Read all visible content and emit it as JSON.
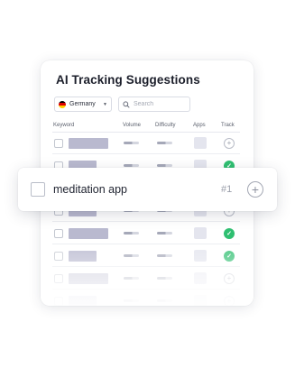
{
  "panel": {
    "title": "AI Tracking Suggestions",
    "country": {
      "label": "Germany",
      "flag_colors": [
        "#000000",
        "#dd0000",
        "#ffce00"
      ]
    },
    "search": {
      "placeholder": "Search",
      "value": ""
    },
    "columns": [
      "Keyword",
      "Volume",
      "Difficulty",
      "Apps",
      "Track"
    ]
  },
  "rows": [
    {
      "track": "add"
    },
    {
      "track": "on"
    },
    {
      "track": "add"
    },
    {
      "track": "add"
    },
    {
      "track": "on"
    },
    {
      "track": "on"
    },
    {
      "track": "add"
    },
    {
      "track": "add"
    }
  ],
  "popup": {
    "keyword": "meditation app",
    "rank": "#1"
  },
  "colors": {
    "track_on": "#2fbf71",
    "placeholder_bar": "#b9b9cf"
  },
  "icons": {
    "search": "search-icon",
    "dropdown": "chevron-down-icon",
    "add": "plus-circle-icon",
    "tracked": "check-circle-icon"
  }
}
